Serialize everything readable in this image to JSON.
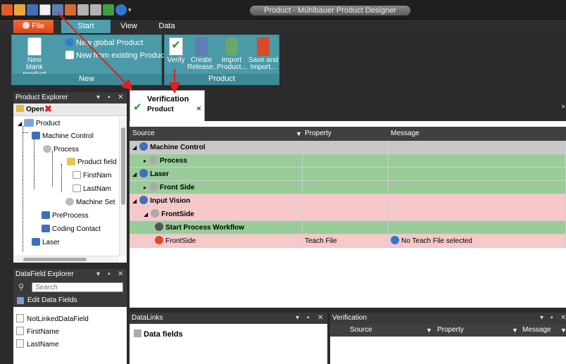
{
  "window": {
    "title": "Product - Mühlbauer Product Designer"
  },
  "ribbon_tabs": {
    "file": "File",
    "start": "Start",
    "view": "View",
    "data": "Data"
  },
  "ribbon": {
    "new_group": {
      "label": "New",
      "new_blank_line1": "New",
      "new_blank_line2": "blank product",
      "new_global": "New global Product",
      "new_from_existing": "New from existing Product"
    },
    "product_group": {
      "label": "Product",
      "verify": "Verify",
      "create_release_1": "Create",
      "create_release_2": "Release...",
      "import_product_1": "Import",
      "import_product_2": "Product...",
      "save_import_1": "Save and",
      "save_import_2": "Import..."
    }
  },
  "product_explorer": {
    "title": "Product Explorer",
    "open": "Open",
    "tree": {
      "product": "Product",
      "machine_control": "Machine Control",
      "process": "Process",
      "product_field": "Product field",
      "first_name": "FirstNam",
      "last_name": "LastNam",
      "machine_set": "Machine Set",
      "preprocess": "PreProcess",
      "coding_contact": "Coding Contact",
      "laser": "Laser"
    }
  },
  "datafield_explorer": {
    "title": "DataField Explorer",
    "search_placeholder": "Search",
    "edit": "Edit Data Fields",
    "items": [
      "NotLinkedDataField",
      "FirstName",
      "LastName"
    ]
  },
  "doc_tab": {
    "title": "Verification",
    "subtitle": "Product",
    "close": "×"
  },
  "verification_grid": {
    "headers": {
      "source": "Source",
      "property": "Property",
      "message": "Message"
    },
    "rows": [
      {
        "source": "Machine Control",
        "property": "",
        "message": "",
        "bold": true
      },
      {
        "source": "Process",
        "property": "",
        "message": "",
        "bold": true
      },
      {
        "source": "Laser",
        "property": "",
        "message": "",
        "bold": true
      },
      {
        "source": "Front Side",
        "property": "",
        "message": "",
        "bold": true
      },
      {
        "source": "Input Vision",
        "property": "",
        "message": "",
        "bold": true
      },
      {
        "source": "FrontSide",
        "property": "",
        "message": "",
        "bold": true
      },
      {
        "source": "Start Process Workflow",
        "property": "",
        "message": "",
        "bold": true
      },
      {
        "source": "FrontSide",
        "property": "Teach File",
        "message": "No Teach File selected",
        "bold": false
      }
    ]
  },
  "datalinks": {
    "title": "DataLinks",
    "item": "Data fields"
  },
  "verification_panel": {
    "title": "Verification",
    "headers": {
      "source": "Source",
      "property": "Property",
      "message": "Message"
    }
  },
  "colors": {
    "accent": "#4c9fad",
    "file_tab": "#e0521f",
    "row_gray": "#c8c8c8",
    "row_green": "#99cc99",
    "row_pink": "#f6c8c8",
    "arrow": "#e02020"
  }
}
